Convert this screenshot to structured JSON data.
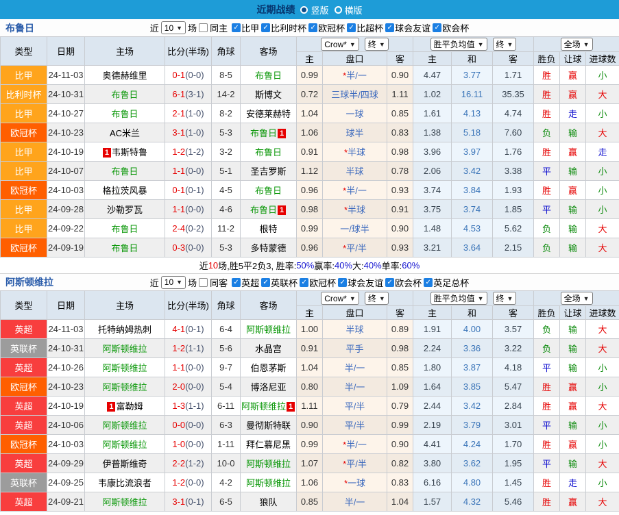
{
  "title_bar": {
    "title": "近期战绩",
    "radios": [
      {
        "label": "竖版",
        "selected": true
      },
      {
        "label": "横版",
        "selected": false
      }
    ]
  },
  "table_header": {
    "type": "类型",
    "date": "日期",
    "home": "主场",
    "score": "比分(半场)",
    "corners": "角球",
    "away": "客场",
    "odds_select": "Crow*",
    "odds_final": "终",
    "wdl_select": "胜平负均值",
    "wdl_final": "终",
    "scope_select": "全场",
    "odds_home": "主",
    "odds_handicap": "盘口",
    "odds_away": "客",
    "wdl_home": "主",
    "wdl_draw": "和",
    "wdl_away": "客",
    "res_outcome": "胜负",
    "res_handicap": "让球",
    "res_goals": "进球数"
  },
  "league_colors": {
    "比甲": "#ffa41c",
    "比利时杯": "#ffa41c",
    "欧冠杯": "#ff5f00",
    "英超": "#f83e3e",
    "英联杯": "#9c9c9c"
  },
  "result_colors": {
    "胜": "red",
    "平": "blue",
    "负": "green",
    "赢": "red",
    "走": "blue",
    "输": "green",
    "大": "red",
    "小": "green"
  },
  "sections": [
    {
      "team": "布鲁日",
      "filters": {
        "recent_prefix": "近",
        "recent_value": "10",
        "recent_suffix": "场",
        "venue_label": "同主",
        "venue_checked": false,
        "leagues": [
          "比甲",
          "比利时杯",
          "欧冠杯",
          "比超杯",
          "球会友谊",
          "欧会杯"
        ]
      },
      "rows": [
        {
          "league": "比甲",
          "date": "24-11-03",
          "home": "奥德赫维里",
          "home_green": false,
          "home_badge": "",
          "ft": "0-1",
          "ht": "(0-0)",
          "corners": "8-5",
          "away": "布鲁日",
          "away_green": true,
          "away_badge": "",
          "o_home": "0.99",
          "hcap_star": true,
          "hcap": "半/一",
          "o_away": "0.90",
          "a_home": "4.47",
          "a_draw": "3.77",
          "a_away": "1.71",
          "r1": "胜",
          "r2": "赢",
          "r3": "小"
        },
        {
          "league": "比利时杯",
          "date": "24-10-31",
          "home": "布鲁日",
          "home_green": true,
          "home_badge": "",
          "ft": "6-1",
          "ht": "(3-1)",
          "corners": "14-2",
          "away": "斯博文",
          "away_green": false,
          "away_badge": "",
          "o_home": "0.72",
          "hcap_star": false,
          "hcap": "三球半/四球",
          "o_away": "1.11",
          "a_home": "1.02",
          "a_draw": "16.11",
          "a_away": "35.35",
          "r1": "胜",
          "r2": "赢",
          "r3": "大"
        },
        {
          "league": "比甲",
          "date": "24-10-27",
          "home": "布鲁日",
          "home_green": true,
          "home_badge": "",
          "ft": "2-1",
          "ht": "(1-0)",
          "corners": "8-2",
          "away": "安德莱赫特",
          "away_green": false,
          "away_badge": "",
          "o_home": "1.04",
          "hcap_star": false,
          "hcap": "一球",
          "o_away": "0.85",
          "a_home": "1.61",
          "a_draw": "4.13",
          "a_away": "4.74",
          "r1": "胜",
          "r2": "走",
          "r3": "小"
        },
        {
          "league": "欧冠杯",
          "date": "24-10-23",
          "home": "AC米兰",
          "home_green": false,
          "home_badge": "",
          "ft": "3-1",
          "ht": "(1-0)",
          "corners": "5-3",
          "away": "布鲁日",
          "away_green": true,
          "away_badge": "1",
          "o_home": "1.06",
          "hcap_star": false,
          "hcap": "球半",
          "o_away": "0.83",
          "a_home": "1.38",
          "a_draw": "5.18",
          "a_away": "7.60",
          "r1": "负",
          "r2": "输",
          "r3": "大"
        },
        {
          "league": "比甲",
          "date": "24-10-19",
          "home": "韦斯特鲁",
          "home_green": false,
          "home_badge": "1",
          "ft": "1-2",
          "ht": "(1-2)",
          "corners": "3-2",
          "away": "布鲁日",
          "away_green": true,
          "away_badge": "",
          "o_home": "0.91",
          "hcap_star": true,
          "hcap": "半球",
          "o_away": "0.98",
          "a_home": "3.96",
          "a_draw": "3.97",
          "a_away": "1.76",
          "r1": "胜",
          "r2": "赢",
          "r3": "走"
        },
        {
          "league": "比甲",
          "date": "24-10-07",
          "home": "布鲁日",
          "home_green": true,
          "home_badge": "",
          "ft": "1-1",
          "ht": "(0-0)",
          "corners": "5-1",
          "away": "圣吉罗斯",
          "away_green": false,
          "away_badge": "",
          "o_home": "1.12",
          "hcap_star": false,
          "hcap": "半球",
          "o_away": "0.78",
          "a_home": "2.06",
          "a_draw": "3.42",
          "a_away": "3.38",
          "r1": "平",
          "r2": "输",
          "r3": "小"
        },
        {
          "league": "欧冠杯",
          "date": "24-10-03",
          "home": "格拉茨风暴",
          "home_green": false,
          "home_badge": "",
          "ft": "0-1",
          "ht": "(0-1)",
          "corners": "4-5",
          "away": "布鲁日",
          "away_green": true,
          "away_badge": "",
          "o_home": "0.96",
          "hcap_star": true,
          "hcap": "半/一",
          "o_away": "0.93",
          "a_home": "3.74",
          "a_draw": "3.84",
          "a_away": "1.93",
          "r1": "胜",
          "r2": "赢",
          "r3": "小"
        },
        {
          "league": "比甲",
          "date": "24-09-28",
          "home": "沙勒罗瓦",
          "home_green": false,
          "home_badge": "",
          "ft": "1-1",
          "ht": "(0-0)",
          "corners": "4-6",
          "away": "布鲁日",
          "away_green": true,
          "away_badge": "1",
          "o_home": "0.98",
          "hcap_star": true,
          "hcap": "半球",
          "o_away": "0.91",
          "a_home": "3.75",
          "a_draw": "3.74",
          "a_away": "1.85",
          "r1": "平",
          "r2": "输",
          "r3": "小"
        },
        {
          "league": "比甲",
          "date": "24-09-22",
          "home": "布鲁日",
          "home_green": true,
          "home_badge": "",
          "ft": "2-4",
          "ht": "(0-2)",
          "corners": "11-2",
          "away": "根特",
          "away_green": false,
          "away_badge": "",
          "o_home": "0.99",
          "hcap_star": false,
          "hcap": "一/球半",
          "o_away": "0.90",
          "a_home": "1.48",
          "a_draw": "4.53",
          "a_away": "5.62",
          "r1": "负",
          "r2": "输",
          "r3": "大"
        },
        {
          "league": "欧冠杯",
          "date": "24-09-19",
          "home": "布鲁日",
          "home_green": true,
          "home_badge": "",
          "ft": "0-3",
          "ht": "(0-0)",
          "corners": "5-3",
          "away": "多特蒙德",
          "away_green": false,
          "away_badge": "",
          "o_home": "0.96",
          "hcap_star": true,
          "hcap": "平/半",
          "o_away": "0.93",
          "a_home": "3.21",
          "a_draw": "3.64",
          "a_away": "2.15",
          "r1": "负",
          "r2": "输",
          "r3": "大"
        }
      ],
      "summary_segments": [
        {
          "t": "近",
          "c": "black"
        },
        {
          "t": "10",
          "c": "red"
        },
        {
          "t": "场,胜5平2负3, 胜率:",
          "c": "black"
        },
        {
          "t": "50%",
          "c": "blue"
        },
        {
          "t": " 赢率:",
          "c": "black"
        },
        {
          "t": "40%",
          "c": "blue"
        },
        {
          "t": " 大:",
          "c": "black"
        },
        {
          "t": "40%",
          "c": "blue"
        },
        {
          "t": " 单率:",
          "c": "black"
        },
        {
          "t": "60%",
          "c": "blue"
        }
      ]
    },
    {
      "team": "阿斯顿维拉",
      "filters": {
        "recent_prefix": "近",
        "recent_value": "10",
        "recent_suffix": "场",
        "venue_label": "同客",
        "venue_checked": false,
        "leagues": [
          "英超",
          "英联杯",
          "欧冠杯",
          "球会友谊",
          "欧会杯",
          "英足总杯"
        ]
      },
      "rows": [
        {
          "league": "英超",
          "date": "24-11-03",
          "home": "托特纳姆热刺",
          "home_green": false,
          "home_badge": "",
          "ft": "4-1",
          "ht": "(0-1)",
          "corners": "6-4",
          "away": "阿斯顿维拉",
          "away_green": true,
          "away_badge": "",
          "o_home": "1.00",
          "hcap_star": false,
          "hcap": "半球",
          "o_away": "0.89",
          "a_home": "1.91",
          "a_draw": "4.00",
          "a_away": "3.57",
          "r1": "负",
          "r2": "输",
          "r3": "大"
        },
        {
          "league": "英联杯",
          "date": "24-10-31",
          "home": "阿斯顿维拉",
          "home_green": true,
          "home_badge": "",
          "ft": "1-2",
          "ht": "(1-1)",
          "corners": "5-6",
          "away": "水晶宫",
          "away_green": false,
          "away_badge": "",
          "o_home": "0.91",
          "hcap_star": false,
          "hcap": "平手",
          "o_away": "0.98",
          "a_home": "2.24",
          "a_draw": "3.36",
          "a_away": "3.22",
          "r1": "负",
          "r2": "输",
          "r3": "大"
        },
        {
          "league": "英超",
          "date": "24-10-26",
          "home": "阿斯顿维拉",
          "home_green": true,
          "home_badge": "",
          "ft": "1-1",
          "ht": "(0-0)",
          "corners": "9-7",
          "away": "伯恩茅斯",
          "away_green": false,
          "away_badge": "",
          "o_home": "1.04",
          "hcap_star": false,
          "hcap": "半/一",
          "o_away": "0.85",
          "a_home": "1.80",
          "a_draw": "3.87",
          "a_away": "4.18",
          "r1": "平",
          "r2": "输",
          "r3": "小"
        },
        {
          "league": "欧冠杯",
          "date": "24-10-23",
          "home": "阿斯顿维拉",
          "home_green": true,
          "home_badge": "",
          "ft": "2-0",
          "ht": "(0-0)",
          "corners": "5-4",
          "away": "博洛尼亚",
          "away_green": false,
          "away_badge": "",
          "o_home": "0.80",
          "hcap_star": false,
          "hcap": "半/一",
          "o_away": "1.09",
          "a_home": "1.64",
          "a_draw": "3.85",
          "a_away": "5.47",
          "r1": "胜",
          "r2": "赢",
          "r3": "小"
        },
        {
          "league": "英超",
          "date": "24-10-19",
          "home": "富勒姆",
          "home_green": false,
          "home_badge": "1",
          "ft": "1-3",
          "ht": "(1-1)",
          "corners": "6-11",
          "away": "阿斯顿维拉",
          "away_green": true,
          "away_badge": "1",
          "o_home": "1.11",
          "hcap_star": false,
          "hcap": "平/半",
          "o_away": "0.79",
          "a_home": "2.44",
          "a_draw": "3.42",
          "a_away": "2.84",
          "r1": "胜",
          "r2": "赢",
          "r3": "大"
        },
        {
          "league": "英超",
          "date": "24-10-06",
          "home": "阿斯顿维拉",
          "home_green": true,
          "home_badge": "",
          "ft": "0-0",
          "ht": "(0-0)",
          "corners": "6-3",
          "away": "曼彻斯特联",
          "away_green": false,
          "away_badge": "",
          "o_home": "0.90",
          "hcap_star": false,
          "hcap": "平/半",
          "o_away": "0.99",
          "a_home": "2.19",
          "a_draw": "3.79",
          "a_away": "3.01",
          "r1": "平",
          "r2": "输",
          "r3": "小"
        },
        {
          "league": "欧冠杯",
          "date": "24-10-03",
          "home": "阿斯顿维拉",
          "home_green": true,
          "home_badge": "",
          "ft": "1-0",
          "ht": "(0-0)",
          "corners": "1-11",
          "away": "拜仁慕尼黑",
          "away_green": false,
          "away_badge": "",
          "o_home": "0.99",
          "hcap_star": true,
          "hcap": "半/一",
          "o_away": "0.90",
          "a_home": "4.41",
          "a_draw": "4.24",
          "a_away": "1.70",
          "r1": "胜",
          "r2": "赢",
          "r3": "小"
        },
        {
          "league": "英超",
          "date": "24-09-29",
          "home": "伊普斯维奇",
          "home_green": false,
          "home_badge": "",
          "ft": "2-2",
          "ht": "(1-2)",
          "corners": "10-0",
          "away": "阿斯顿维拉",
          "away_green": true,
          "away_badge": "",
          "o_home": "1.07",
          "hcap_star": true,
          "hcap": "平/半",
          "o_away": "0.82",
          "a_home": "3.80",
          "a_draw": "3.62",
          "a_away": "1.95",
          "r1": "平",
          "r2": "输",
          "r3": "大"
        },
        {
          "league": "英联杯",
          "date": "24-09-25",
          "home": "韦康比流浪者",
          "home_green": false,
          "home_badge": "",
          "ft": "1-2",
          "ht": "(0-0)",
          "corners": "4-2",
          "away": "阿斯顿维拉",
          "away_green": true,
          "away_badge": "",
          "o_home": "1.06",
          "hcap_star": true,
          "hcap": "一球",
          "o_away": "0.83",
          "a_home": "6.16",
          "a_draw": "4.80",
          "a_away": "1.45",
          "r1": "胜",
          "r2": "走",
          "r3": "小"
        },
        {
          "league": "英超",
          "date": "24-09-21",
          "home": "阿斯顿维拉",
          "home_green": true,
          "home_badge": "",
          "ft": "3-1",
          "ht": "(0-1)",
          "corners": "6-5",
          "away": "狼队",
          "away_green": false,
          "away_badge": "",
          "o_home": "0.85",
          "hcap_star": false,
          "hcap": "半/一",
          "o_away": "1.04",
          "a_home": "1.57",
          "a_draw": "4.32",
          "a_away": "5.46",
          "r1": "胜",
          "r2": "赢",
          "r3": "大"
        }
      ],
      "summary_segments": []
    }
  ]
}
